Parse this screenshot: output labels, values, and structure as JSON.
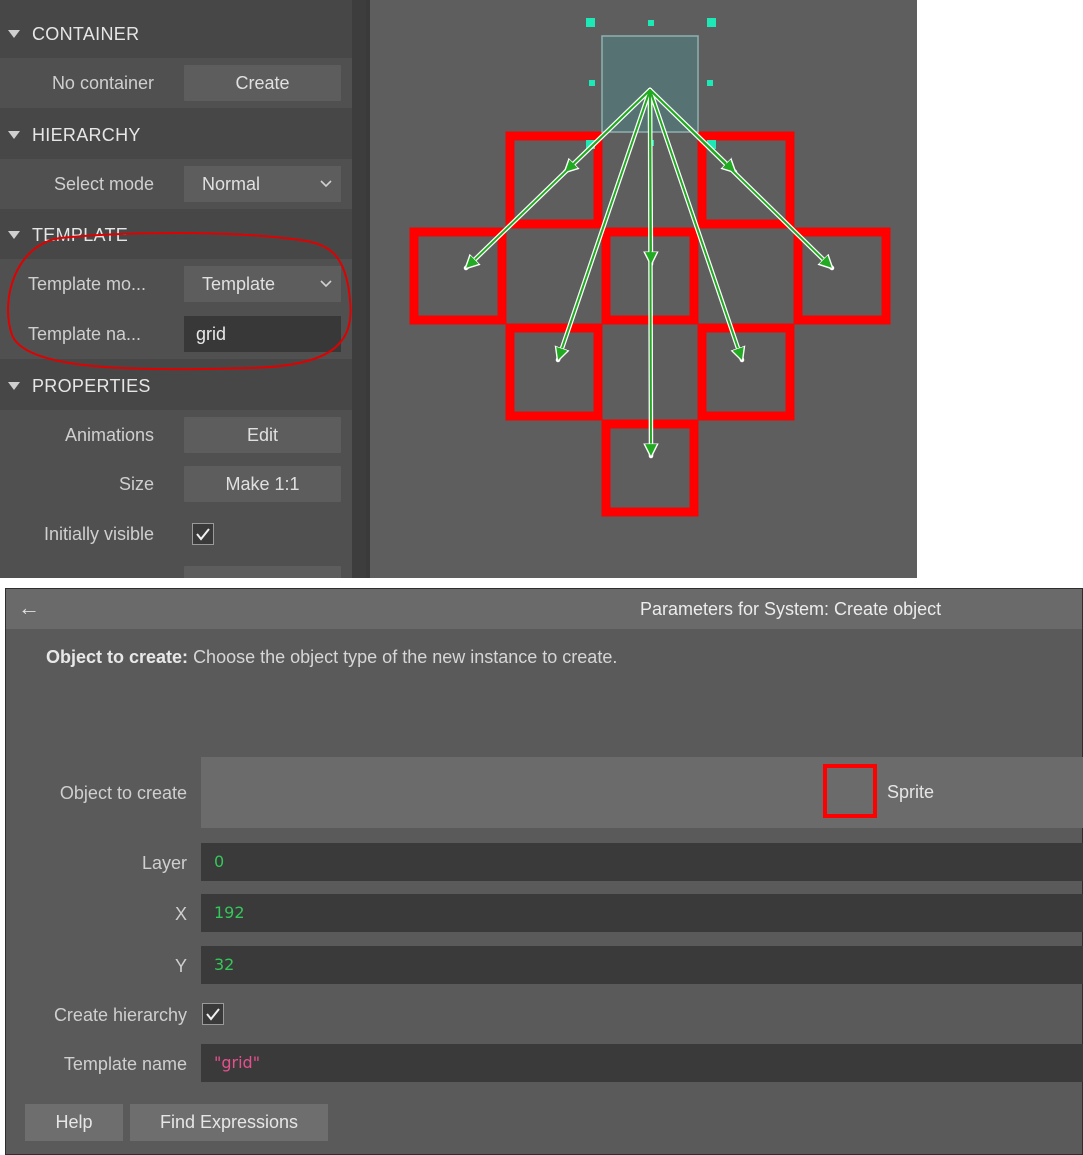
{
  "properties_panel": {
    "container": {
      "header": "CONTAINER",
      "no_container_label": "No container",
      "create_button": "Create"
    },
    "hierarchy": {
      "header": "HIERARCHY",
      "select_mode_label": "Select mode",
      "select_mode_value": "Normal"
    },
    "template": {
      "header": "TEMPLATE",
      "template_mode_label": "Template mo...",
      "template_mode_value": "Template",
      "template_name_label": "Template na...",
      "template_name_value": "grid"
    },
    "properties": {
      "header": "PROPERTIES",
      "animations_label": "Animations",
      "animations_button": "Edit",
      "size_label": "Size",
      "size_button": "Make 1:1",
      "initially_visible_label": "Initially visible",
      "initially_visible_checked": true
    }
  },
  "canvas": {
    "grid_columns": 5,
    "grid_rows": 5,
    "selected_cell": "top-center",
    "colors": {
      "background": "#5e5e5e",
      "cell_border": "#ff0000",
      "arrow": "#22aa22",
      "handle": "#1de9b6",
      "selected_fill": "#567272"
    }
  },
  "dialog": {
    "title": "Parameters for System: Create object",
    "description_bold": "Object to create:",
    "description_text": "Choose the object type of the new instance to create.",
    "params": {
      "object_to_create_label": "Object to create",
      "object_to_create_value": "Sprite",
      "layer_label": "Layer",
      "layer_value": "0",
      "x_label": "X",
      "x_value": "192",
      "y_label": "Y",
      "y_value": "32",
      "create_hierarchy_label": "Create hierarchy",
      "create_hierarchy_checked": true,
      "template_name_label": "Template name",
      "template_name_value": "\"grid\""
    },
    "buttons": {
      "help": "Help",
      "find_expressions": "Find Expressions"
    }
  }
}
